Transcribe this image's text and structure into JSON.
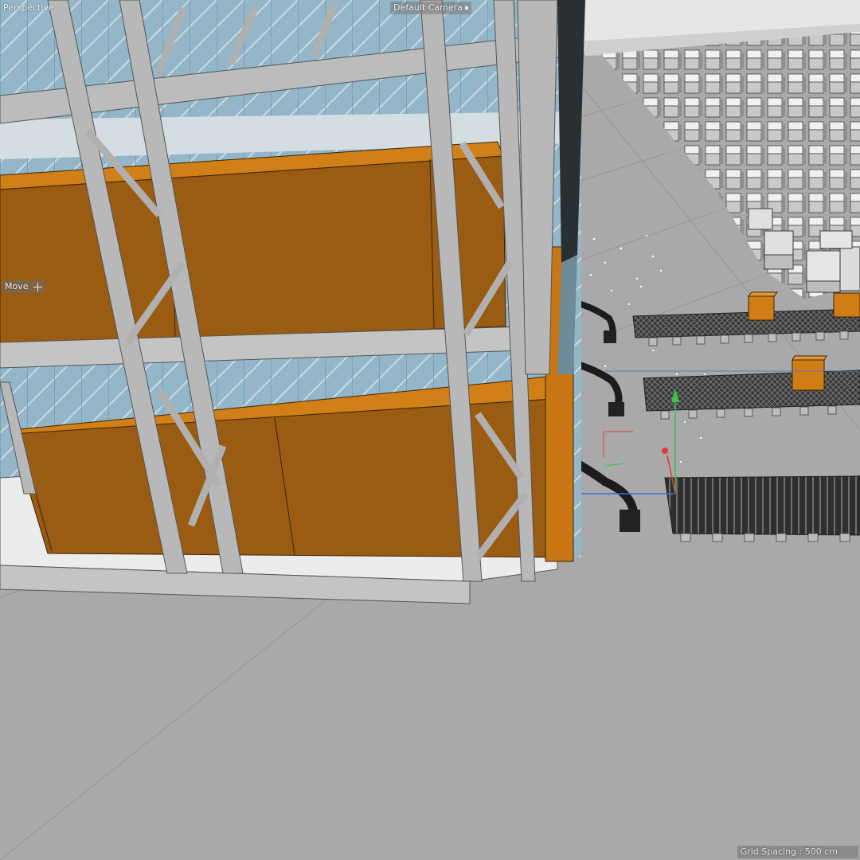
{
  "viewport": {
    "view_name": "Perspective",
    "camera_label": "Default Camera",
    "active_tool": "Move",
    "grid_spacing": "Grid Spacing : 500 cm"
  },
  "colors": {
    "floor": "#a9a9a9",
    "sky": "#e6e6e6",
    "steel": "#b8b8b8",
    "container_front": "#995c12",
    "container_top": "#d17f17",
    "glass": "#8fb2c6",
    "box_white": "#e0e0e0",
    "conveyor": "#2a2a2a",
    "robot_arm": "#1c1c1c",
    "axis_x": "#e23b3b",
    "axis_y": "#39c44a",
    "axis_z": "#3b6fe2",
    "hud_text": "#f2f2f2"
  },
  "icons": {
    "move_tool": "move-crosshair-icon",
    "camera_menu": "camera-menu-icon"
  }
}
